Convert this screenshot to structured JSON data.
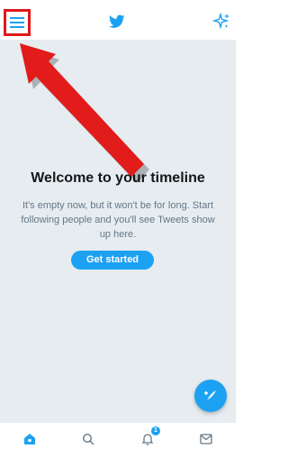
{
  "app": "Twitter",
  "colors": {
    "accent": "#1da1f2",
    "annotation_red": "#e0181b",
    "background": "#e6ecf0",
    "heading": "#14171a",
    "muted": "#657786"
  },
  "header": {
    "menu_icon": "hamburger-menu-icon",
    "logo_icon": "twitter-bird-icon",
    "sparkle_icon": "sparkle-icon"
  },
  "timeline": {
    "title": "Welcome to your timeline",
    "subtitle": "It's empty now, but it won't be for long. Start following people and you'll see Tweets show up here.",
    "cta_label": "Get started"
  },
  "fab": {
    "icon": "compose-tweet-icon"
  },
  "tabs": [
    {
      "name": "home",
      "icon": "home-icon",
      "active": true
    },
    {
      "name": "search",
      "icon": "search-icon",
      "active": false
    },
    {
      "name": "notifications",
      "icon": "bell-icon",
      "active": false,
      "badge": "1"
    },
    {
      "name": "messages",
      "icon": "mail-icon",
      "active": false
    }
  ]
}
